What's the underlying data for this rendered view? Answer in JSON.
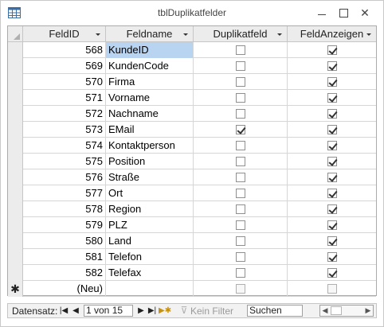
{
  "window": {
    "title": "tblDuplikatfelder"
  },
  "columns": [
    {
      "label": "FeldID"
    },
    {
      "label": "Feldname"
    },
    {
      "label": "Duplikatfeld"
    },
    {
      "label": "FeldAnzeigen"
    }
  ],
  "rows": [
    {
      "id": "568",
      "name": "KundeID",
      "dup": false,
      "show": true,
      "selected": true
    },
    {
      "id": "569",
      "name": "KundenCode",
      "dup": false,
      "show": true
    },
    {
      "id": "570",
      "name": "Firma",
      "dup": false,
      "show": true
    },
    {
      "id": "571",
      "name": "Vorname",
      "dup": false,
      "show": true
    },
    {
      "id": "572",
      "name": "Nachname",
      "dup": false,
      "show": true
    },
    {
      "id": "573",
      "name": "EMail",
      "dup": true,
      "show": true
    },
    {
      "id": "574",
      "name": "Kontaktperson",
      "dup": false,
      "show": true
    },
    {
      "id": "575",
      "name": "Position",
      "dup": false,
      "show": true
    },
    {
      "id": "576",
      "name": "Straße",
      "dup": false,
      "show": true
    },
    {
      "id": "577",
      "name": "Ort",
      "dup": false,
      "show": true
    },
    {
      "id": "578",
      "name": "Region",
      "dup": false,
      "show": true
    },
    {
      "id": "579",
      "name": "PLZ",
      "dup": false,
      "show": true
    },
    {
      "id": "580",
      "name": "Land",
      "dup": false,
      "show": true
    },
    {
      "id": "581",
      "name": "Telefon",
      "dup": false,
      "show": true
    },
    {
      "id": "582",
      "name": "Telefax",
      "dup": false,
      "show": true
    }
  ],
  "new_row": {
    "marker": "✱",
    "id": "(Neu)",
    "dup": false,
    "show": false
  },
  "navigation": {
    "record_label": "Datensatz:",
    "position": "1 von 15",
    "filter_label": "Kein Filter",
    "search_placeholder": "Suchen"
  }
}
